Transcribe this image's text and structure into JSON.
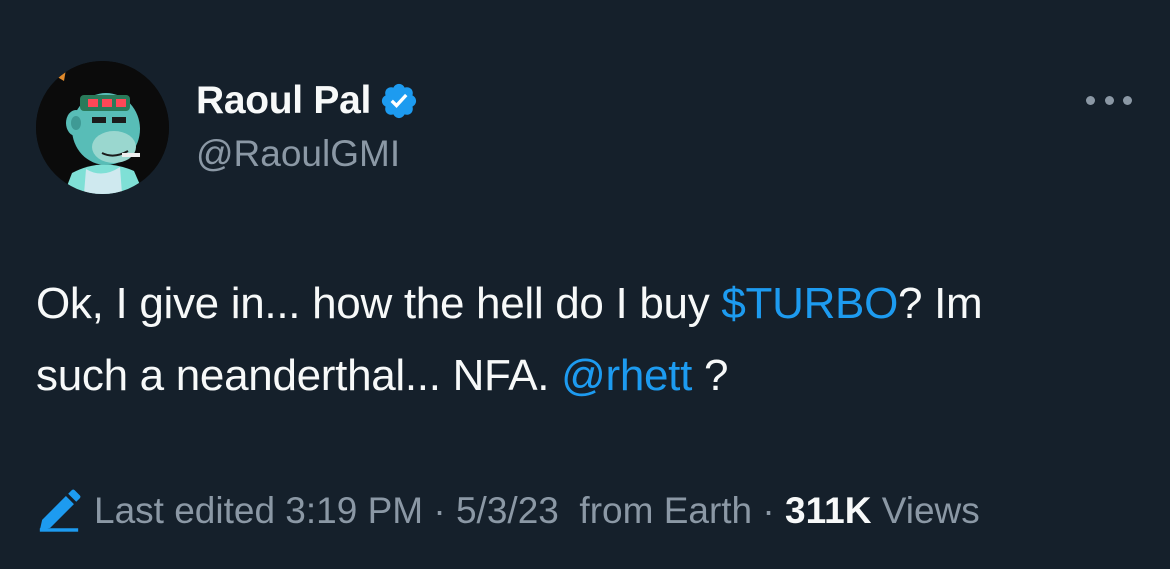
{
  "author": {
    "display_name": "Raoul Pal",
    "handle": "@RaoulGMI",
    "verified": true,
    "avatar_icon": "bored-ape-avatar"
  },
  "menu": {
    "icon": "more-options-icon"
  },
  "tweet": {
    "line1_text": "Ok, I give in... how the hell do I buy ",
    "cashtag": "$TURBO",
    "line1_tail": "? Im",
    "line2_text": "such a neanderthal... NFA. ",
    "mention": "@rhett",
    "line2_tail": " ?"
  },
  "meta": {
    "edited_icon": "pencil-icon",
    "last_edited": "Last edited 3:19 PM · 5/3/23",
    "source": "from Earth ·",
    "views_count": "311K",
    "views_label": "Views"
  },
  "colors": {
    "background": "#15202b",
    "primary_text": "#f7f9f9",
    "secondary_text": "#8b98a5",
    "link": "#1d9bf0"
  }
}
